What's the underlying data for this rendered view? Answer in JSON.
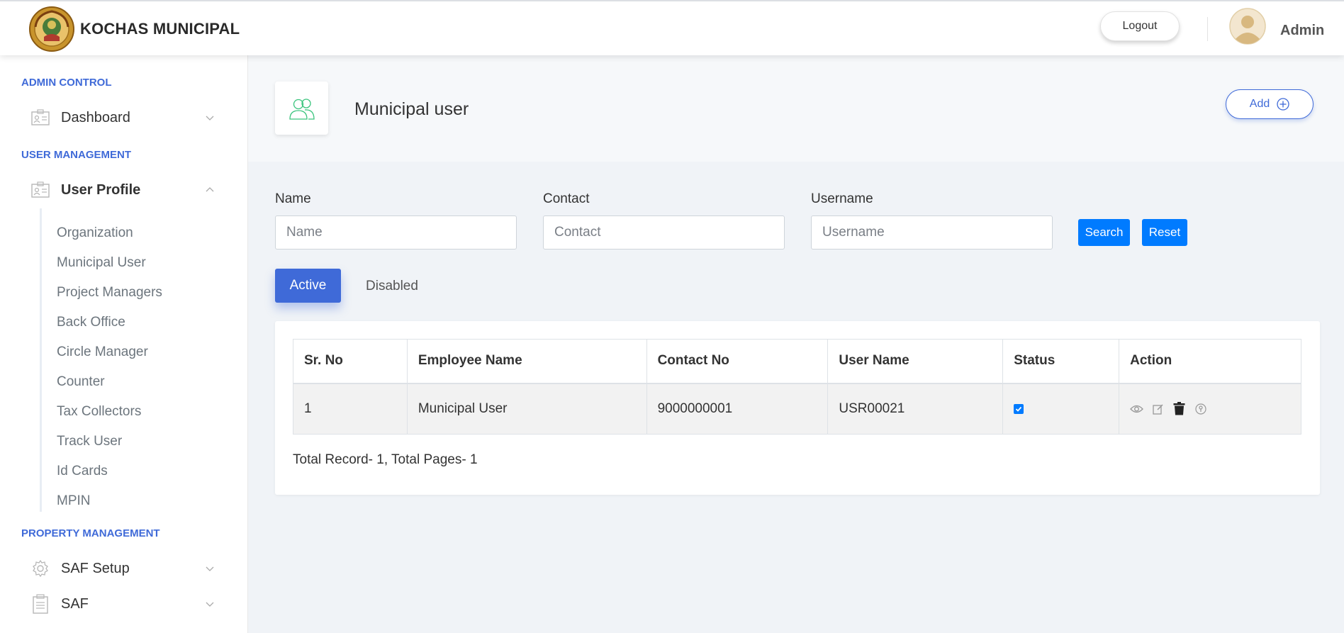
{
  "header": {
    "brand": "KOCHAS MUNICIPAL",
    "logout_label": "Logout",
    "user_name": "Admin"
  },
  "sidebar": {
    "sections": [
      {
        "label": "ADMIN CONTROL"
      },
      {
        "label": "USER MANAGEMENT"
      },
      {
        "label": "PROPERTY MANAGEMENT"
      }
    ],
    "dashboard": {
      "label": "Dashboard",
      "icon": "id-card-icon"
    },
    "user_profile": {
      "label": "User Profile",
      "icon": "id-card-icon",
      "items": [
        "Organization",
        "Municipal User",
        "Project Managers",
        "Back Office",
        "Circle Manager",
        "Counter",
        "Tax Collectors",
        "Track User",
        "Id Cards",
        "MPIN"
      ]
    },
    "saf_setup": {
      "label": "SAF Setup",
      "icon": "gear-icon"
    },
    "saf": {
      "label": "SAF",
      "icon": "clipboard-icon"
    }
  },
  "page": {
    "title": "Municipal user",
    "add_label": "Add"
  },
  "filters": {
    "name": {
      "label": "Name",
      "placeholder": "Name",
      "value": ""
    },
    "contact": {
      "label": "Contact",
      "placeholder": "Contact",
      "value": ""
    },
    "username": {
      "label": "Username",
      "placeholder": "Username",
      "value": ""
    },
    "search_label": "Search",
    "reset_label": "Reset"
  },
  "tabs": {
    "active": "Active",
    "disabled": "Disabled"
  },
  "table": {
    "columns": [
      "Sr. No",
      "Employee Name",
      "Contact No",
      "User Name",
      "Status",
      "Action"
    ],
    "rows": [
      {
        "sr": "1",
        "name": "Municipal User",
        "contact": "9000000001",
        "username": "USR00021",
        "status_checked": true
      }
    ],
    "action_icons": [
      "eye-icon",
      "edit-icon",
      "trash-icon",
      "key-icon"
    ]
  },
  "summary": "Total Record- 1, Total Pages- 1",
  "colors": {
    "accent": "#3f6ad8",
    "primary_button": "#007bff"
  }
}
